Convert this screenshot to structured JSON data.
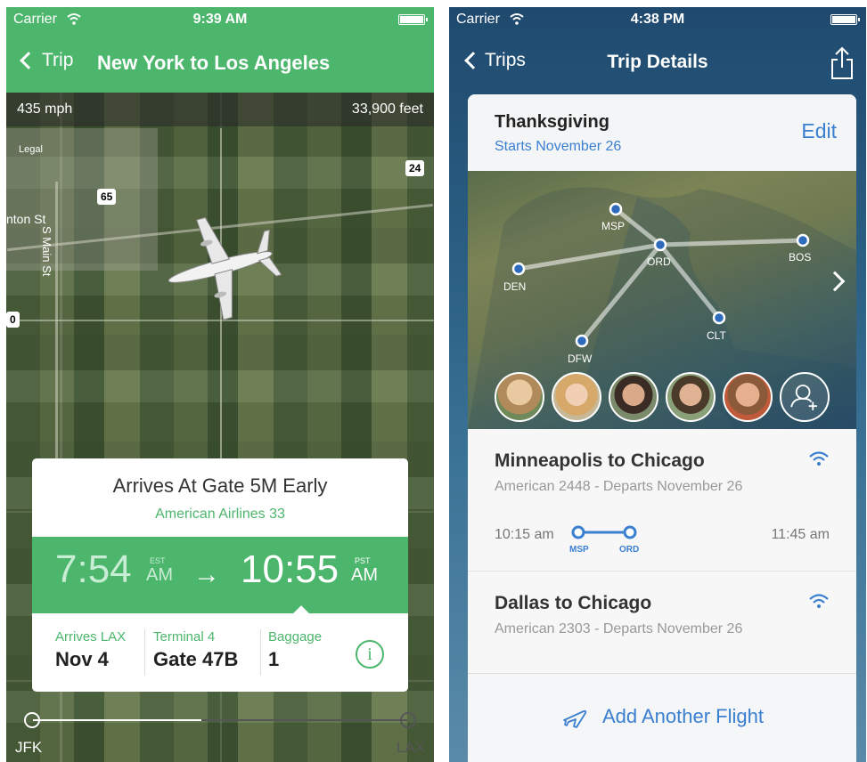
{
  "left_screen": {
    "status_bar": {
      "carrier": "Carrier",
      "time": "9:39 AM"
    },
    "nav": {
      "back_label": "Trip",
      "title": "New York to Los Angeles"
    },
    "map": {
      "speed": "435 mph",
      "altitude": "33,900 feet",
      "legal_label": "Legal",
      "street_label_1": "nton St",
      "street_label_2": "S Main St",
      "route_shield_1": "65",
      "route_shield_2": "24",
      "route_shield_3": "0"
    },
    "flight_card": {
      "status": "Arrives At Gate 5M Early",
      "airline": "American Airlines 33",
      "departure_time": "7:54",
      "departure_zone": "EST",
      "departure_ampm": "AM",
      "arrival_time": "10:55",
      "arrival_zone": "PST",
      "arrival_ampm": "AM",
      "details": [
        {
          "label": "Arrives LAX",
          "value": "Nov 4"
        },
        {
          "label": "Terminal 4",
          "value": "Gate 47B"
        },
        {
          "label": "Baggage",
          "value": "1"
        }
      ],
      "info_icon": "i"
    },
    "progress": {
      "from": "JFK",
      "to": "LAX",
      "fraction": 0.45
    },
    "colors": {
      "accent": "#4db66d"
    }
  },
  "right_screen": {
    "status_bar": {
      "carrier": "Carrier",
      "time": "4:38 PM"
    },
    "nav": {
      "back_label": "Trips",
      "title": "Trip Details",
      "share_icon": "share-icon"
    },
    "trip": {
      "name": "Thanksgiving",
      "starts": "Starts November 26",
      "edit_label": "Edit"
    },
    "map_cities": [
      "MSP",
      "ORD",
      "BOS",
      "DEN",
      "CLT",
      "DFW"
    ],
    "flights": [
      {
        "title": "Minneapolis to Chicago",
        "subtitle": "American 2448 - Departs November 26",
        "depart_time": "10:15 am",
        "arrive_time": "11:45 am",
        "from_code": "MSP",
        "to_code": "ORD"
      },
      {
        "title": "Dallas to Chicago",
        "subtitle": "American 2303 - Departs November 26"
      }
    ],
    "add_flight_label": "Add Another Flight",
    "colors": {
      "accent": "#3a7fd0"
    }
  }
}
